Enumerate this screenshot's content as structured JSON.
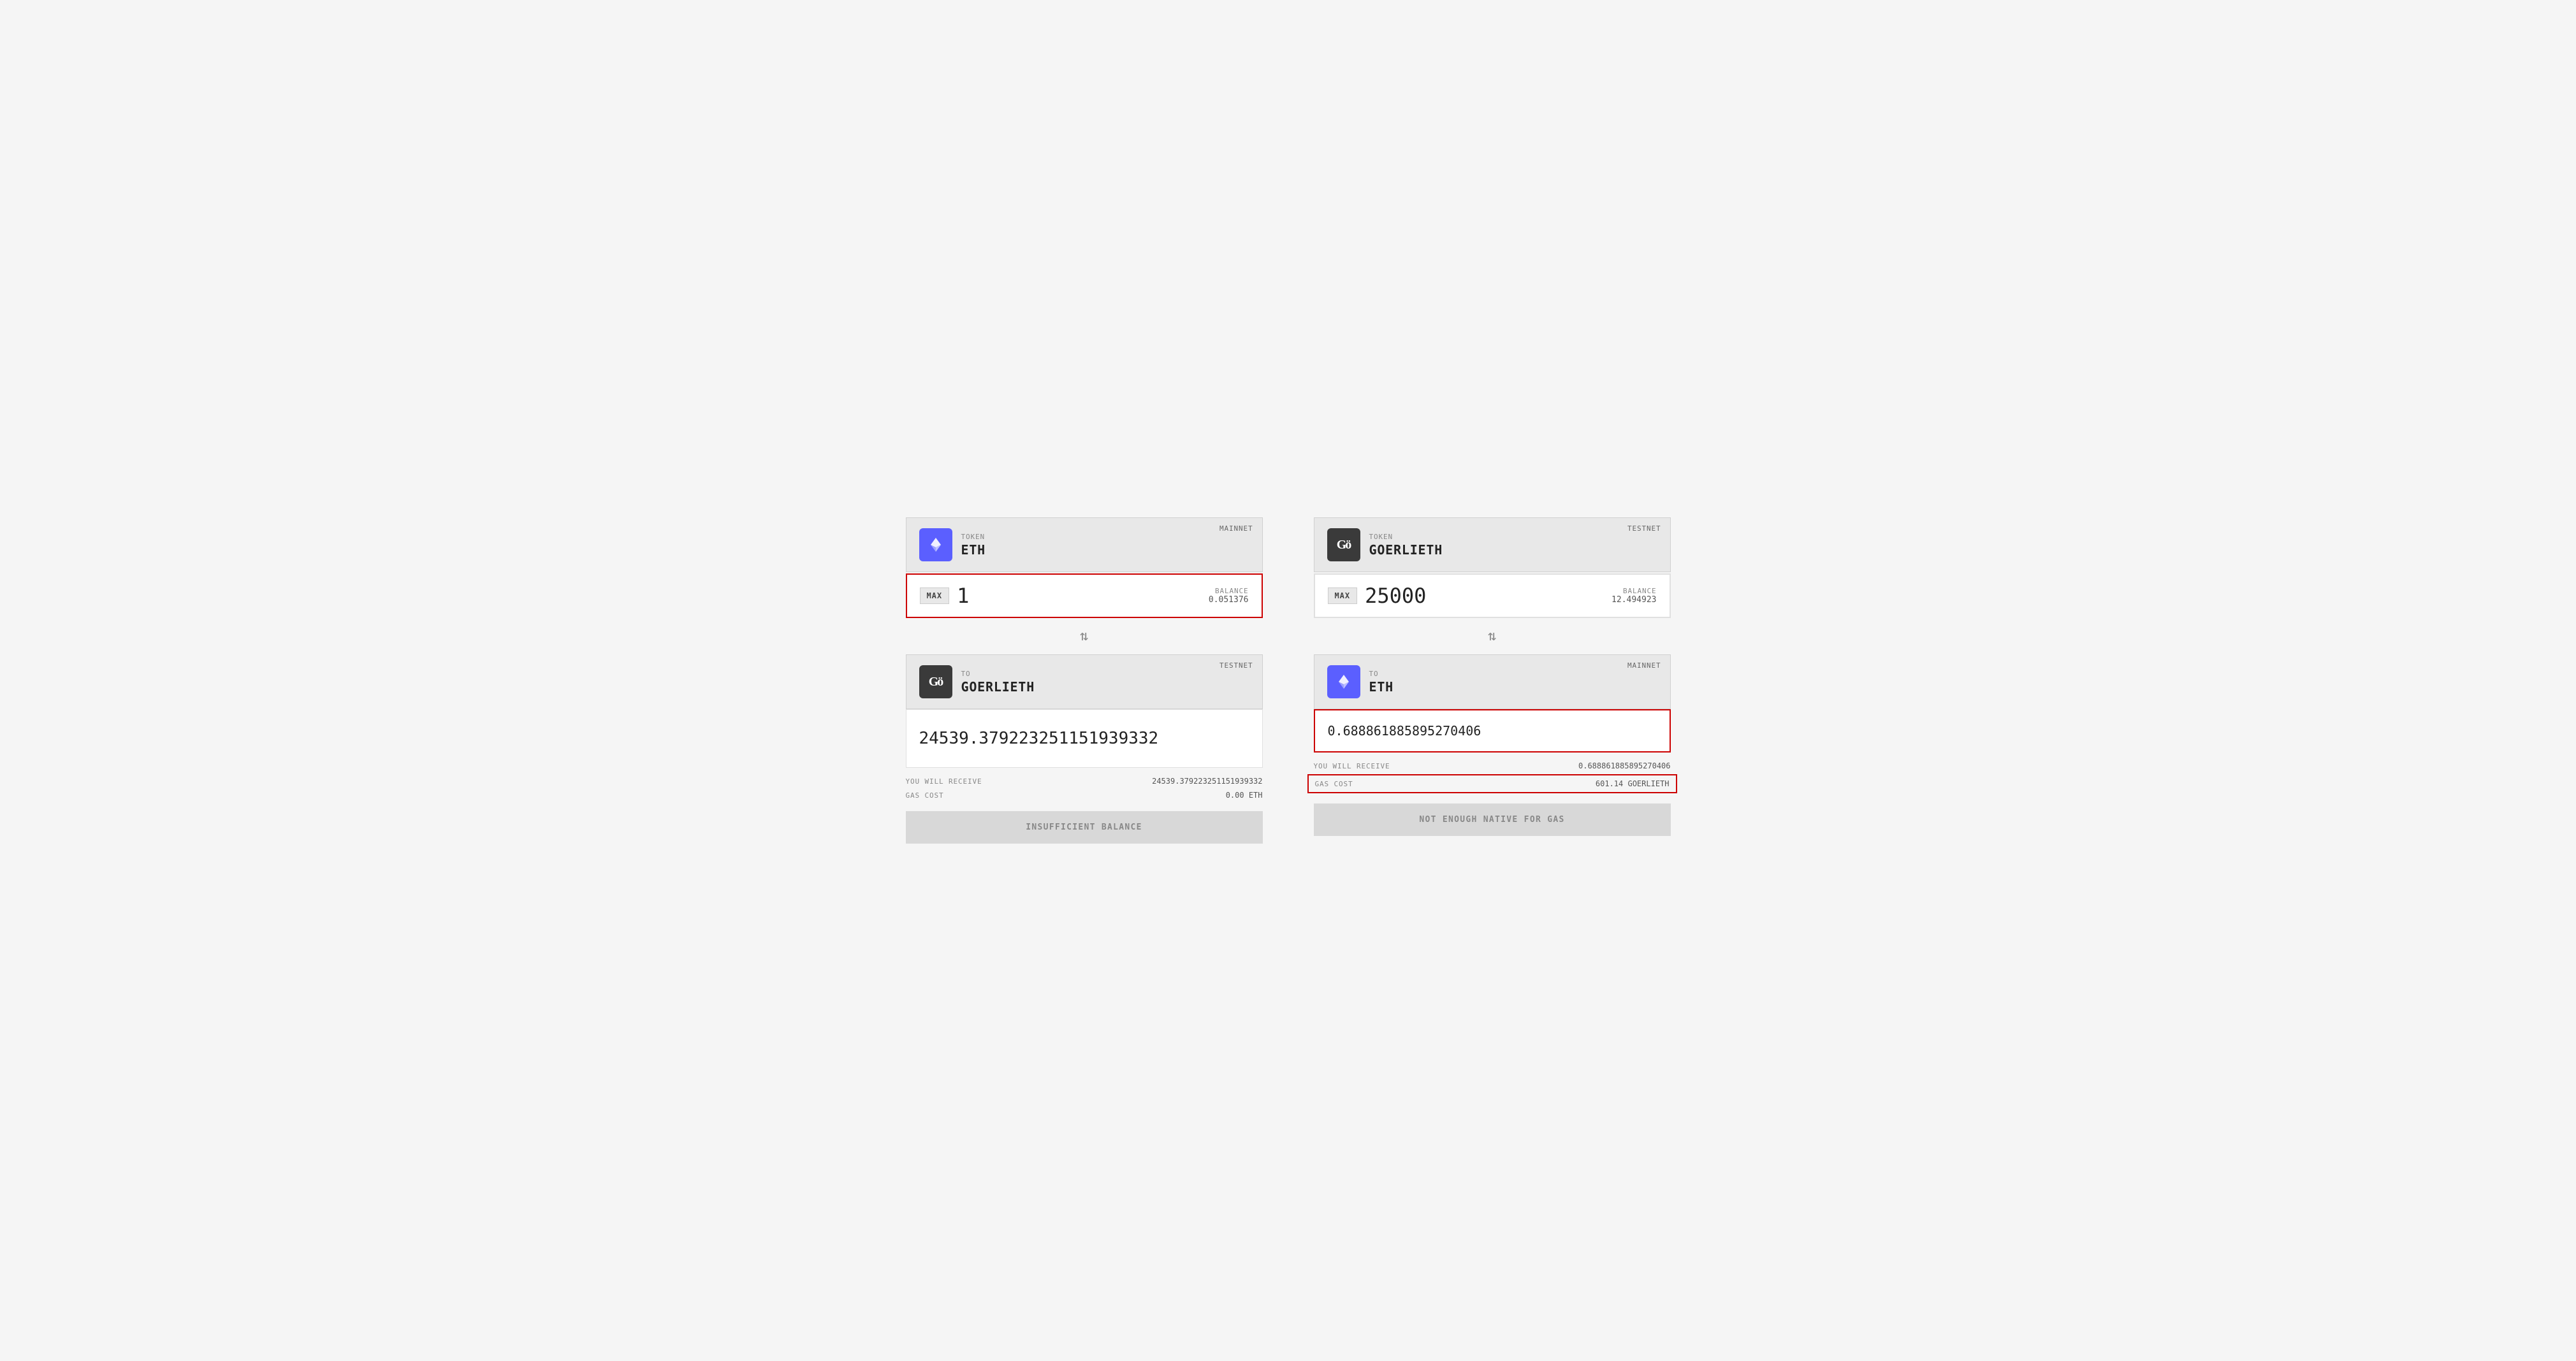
{
  "panel_left": {
    "from": {
      "network": "MAINNET",
      "token_label": "TOKEN",
      "token_name": "ETH",
      "icon_type": "eth"
    },
    "amount": {
      "max_label": "MAX",
      "value": "1",
      "balance_label": "BALANCE",
      "balance_value": "0.051376",
      "highlighted": true
    },
    "swap_arrow": "↕",
    "to": {
      "network": "TESTNET",
      "to_label": "TO",
      "token_name": "GOERLIETH",
      "icon_type": "go",
      "icon_text": "Gö"
    },
    "output_value": "24539.379223251151939332",
    "you_will_receive_label": "YOU WILL RECEIVE",
    "you_will_receive_value": "24539.379223251151939332",
    "gas_cost_label": "GAS COST",
    "gas_cost_value": "0.00 ETH",
    "action_label": "INSUFFICIENT BALANCE"
  },
  "panel_right": {
    "from": {
      "network": "TESTNET",
      "token_label": "TOKEN",
      "token_name": "GOERLIETH",
      "icon_type": "go",
      "icon_text": "Gö"
    },
    "amount": {
      "max_label": "MAX",
      "value": "25000",
      "balance_label": "BALANCE",
      "balance_value": "12.494923",
      "highlighted": false
    },
    "swap_arrow": "↕",
    "to": {
      "network": "MAINNET",
      "to_label": "TO",
      "token_name": "ETH",
      "icon_type": "eth"
    },
    "output_value": "0.68886188589527 0406",
    "output_value_full": "0.688861885895270406",
    "you_will_receive_label": "YOU WILL RECEIVE",
    "you_will_receive_value": "0.688861885895270406",
    "gas_cost_label": "GAS COST",
    "gas_cost_value": "601.14 GOERLIETH",
    "action_label": "NOT ENOUGH NATIVE FOR GAS"
  }
}
